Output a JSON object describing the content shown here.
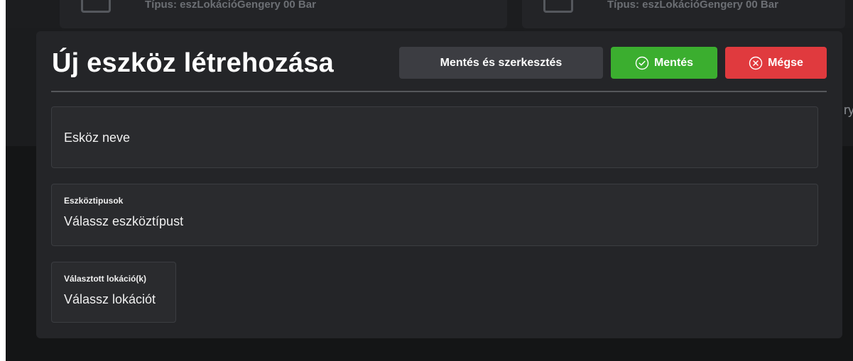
{
  "background": {
    "card_left_text": "Típus: eszLokációGengery 00 Bar",
    "card_right_text": "Típus: eszLokációGengery 00 Bar",
    "edge_char": "ry"
  },
  "modal": {
    "title": "Új eszköz létrehozása",
    "buttons": {
      "save_and_edit": "Mentés és szerkesztés",
      "save": "Mentés",
      "cancel": "Mégse"
    },
    "fields": {
      "device_name": {
        "placeholder": "Esköz neve"
      },
      "device_types": {
        "label": "Eszköztipusok",
        "placeholder": "Válassz eszköztípust"
      },
      "locations": {
        "label": "Választott lokáció(k)",
        "placeholder": "Válassz lokációt"
      }
    }
  },
  "colors": {
    "save": "#3bae2f",
    "cancel": "#e03a3e",
    "neutral_button": "#3c3d42",
    "modal_bg": "#242528",
    "field_bg": "#2a2b2e"
  },
  "icons": {
    "save": "check-circle-icon",
    "cancel": "close-circle-icon"
  }
}
